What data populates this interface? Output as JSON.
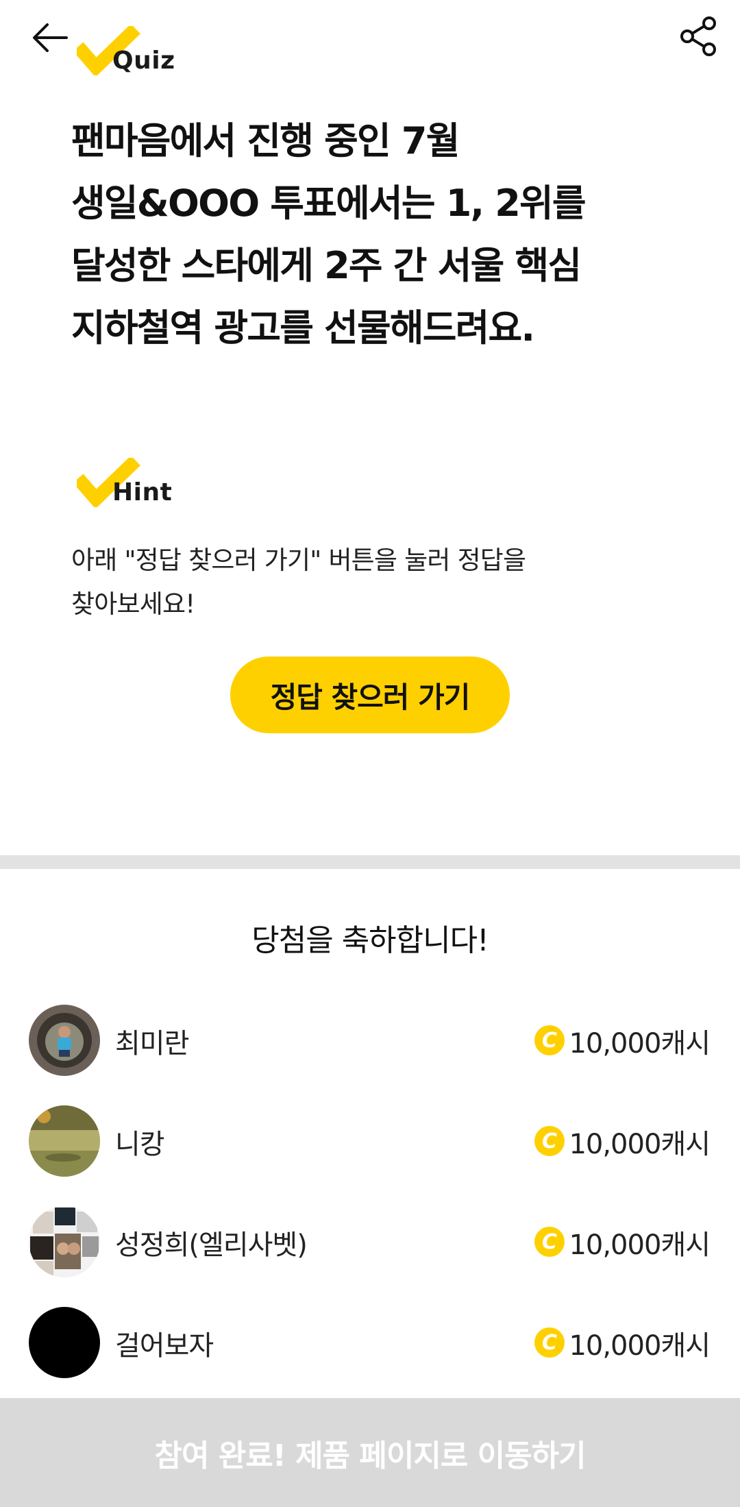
{
  "header": {
    "back_icon": "arrow-left-icon",
    "share_icon": "share-icon",
    "quiz_badge": "Quiz"
  },
  "question": {
    "lines": [
      "팬마음에서 진행 중인 7월",
      "생일&OOO 투표에서는 1, 2위를",
      "달성한 스타에게 2주 간 서울 핵심",
      "지하철역 광고를 선물해드려요."
    ]
  },
  "hint": {
    "badge": "Hint",
    "lines": [
      "아래 \"정답 찾으러 가기\" 버튼을 눌러 정답을",
      "찾아보세요!"
    ],
    "button_label": "정답 찾으러 가기"
  },
  "winners": {
    "title": "당첨을 축하합니다!",
    "coin_symbol": "C",
    "list": [
      {
        "name": "최미란",
        "prize": "10,000캐시",
        "avatar": "photo-child-in-tunnel"
      },
      {
        "name": "니캉",
        "prize": "10,000캐시",
        "avatar": "photo-pond-landscape"
      },
      {
        "name": "성정희(엘리사벳)",
        "prize": "10,000캐시",
        "avatar": "photo-collage"
      },
      {
        "name": "걸어보자",
        "prize": "10,000캐시",
        "avatar": "black-circle"
      }
    ]
  },
  "footer": {
    "cta_label": "참여 완료! 제품 페이지로 이동하기"
  },
  "colors": {
    "accent": "#ffd000",
    "divider": "#e2e2e2",
    "cta_disabled": "#d9d9d9"
  }
}
